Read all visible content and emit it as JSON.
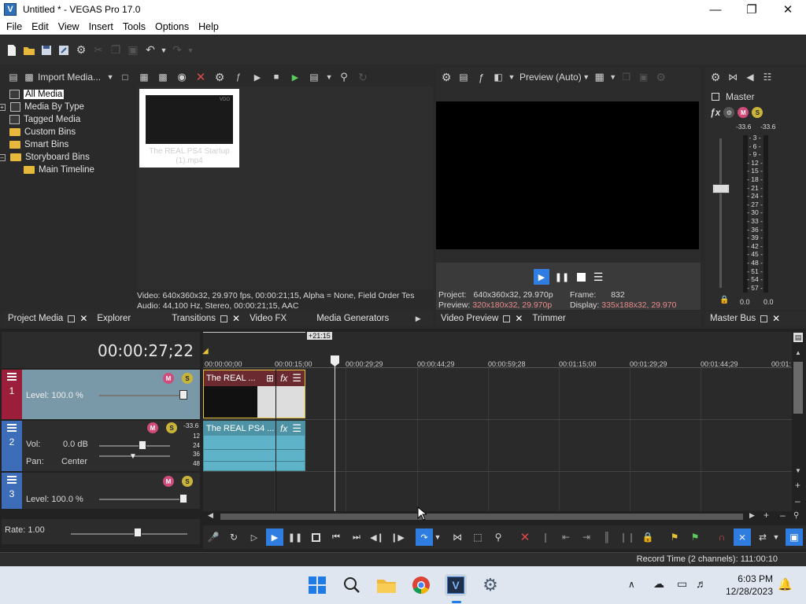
{
  "window": {
    "title": "Untitled * - VEGAS Pro 17.0",
    "logo": "V"
  },
  "menu": [
    "File",
    "Edit",
    "View",
    "Insert",
    "Tools",
    "Options",
    "Help"
  ],
  "project_media": {
    "import_label": "Import Media...",
    "tree": [
      {
        "label": "All Media",
        "selected": true,
        "indent": 0
      },
      {
        "label": "Media By Type",
        "indent": 0
      },
      {
        "label": "Tagged Media",
        "indent": 0
      },
      {
        "label": "Custom Bins",
        "indent": 0
      },
      {
        "label": "Smart Bins",
        "indent": 0
      },
      {
        "label": "Storyboard Bins",
        "indent": 0
      },
      {
        "label": "Main Timeline",
        "indent": 1
      }
    ],
    "thumb_label": "The REAL PS4 Startup (1).mp4",
    "thumb_badge": "VDO",
    "info_video": "Video: 640x360x32, 29.970 fps, 00:00:21;15, Alpha = None, Field Order Tes",
    "info_audio": "Audio: 44,100 Hz, Stereo, 00:00:21;15, AAC"
  },
  "tabs_left": [
    "Project Media",
    "Explorer",
    "Transitions",
    "Video FX",
    "Media Generators"
  ],
  "preview": {
    "mode_label": "Preview (Auto)",
    "project_label": "Project:",
    "project_value": "640x360x32, 29.970p",
    "preview_label": "Preview:",
    "preview_value": "320x180x32, 29.970p",
    "frame_label": "Frame:",
    "frame_value": "832",
    "display_label": "Display:",
    "display_value": "335x188x32, 29.970"
  },
  "tabs_preview": [
    "Video Preview",
    "Trimmer"
  ],
  "master": {
    "title": "Master",
    "peak_left": "-33.6",
    "peak_right": "-33.6",
    "scale": [
      "3",
      "6",
      "9",
      "12",
      "15",
      "18",
      "21",
      "24",
      "27",
      "30",
      "33",
      "36",
      "39",
      "42",
      "45",
      "48",
      "51",
      "54",
      "57"
    ],
    "level_left": "0.0",
    "level_right": "0.0",
    "tab": "Master Bus"
  },
  "timeline": {
    "timecode": "00:00:27;22",
    "loop_label": "+21:15",
    "ruler": [
      "00:00:00;00",
      "00:00:15;00",
      "00:00:29;29",
      "00:00:44;29",
      "00:00:59;28",
      "00:01:15;00",
      "00:01:29;29",
      "00:01:44;29",
      "00:01:"
    ],
    "rate": "Rate: 1.00",
    "tracks": [
      {
        "num": "1",
        "level_label": "Level: 100.0 %",
        "type": "video",
        "color": "#9b1f3a"
      },
      {
        "num": "2",
        "vol_label": "Vol:",
        "vol_value": "0.0 dB",
        "pan_label": "Pan:",
        "pan_value": "Center",
        "meter_peak": "-33.6",
        "meter_scale": [
          "12",
          "24",
          "36",
          "48"
        ],
        "type": "audio",
        "color": "#3d6cb8"
      },
      {
        "num": "3",
        "level_label": "Level: 100.0 %",
        "type": "video",
        "color": "#3d6cb8"
      }
    ],
    "clip_video_label": "The REAL ...",
    "clip_audio_label": "The REAL PS4 ...",
    "fx_label": "fx"
  },
  "status": {
    "record_time": "Record Time (2 channels): 111:00:10"
  },
  "taskbar": {
    "time": "6:03 PM",
    "date": "12/28/2023"
  },
  "colors": {
    "accent": "#2f7de0",
    "video_track": "#9b1f3a",
    "audio_track": "#5eb3c9",
    "clip_header": "#6b2a2f"
  }
}
